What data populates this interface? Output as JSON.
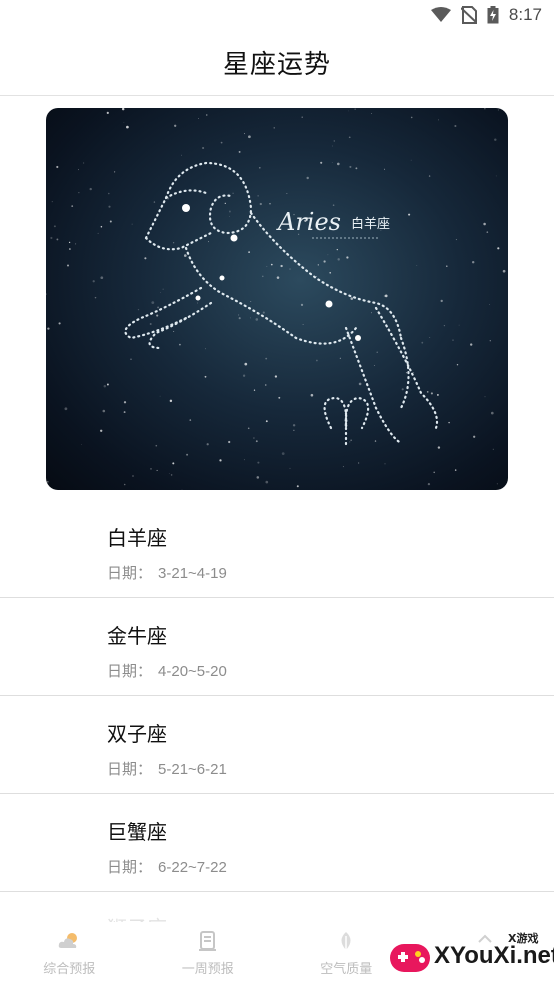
{
  "status_bar": {
    "time": "8:17",
    "icons": [
      "wifi-icon",
      "no-sim-icon",
      "battery-icon"
    ]
  },
  "header": {
    "title": "星座运势"
  },
  "banner": {
    "image_name": "aries-constellation-banner",
    "overlay_title": "Aries",
    "overlay_subtitle": "白羊座"
  },
  "zodiac_list": [
    {
      "name": "白羊座",
      "date_label": "日期：",
      "date_range": "3-21~4-19"
    },
    {
      "name": "金牛座",
      "date_label": "日期：",
      "date_range": "4-20~5-20"
    },
    {
      "name": "双子座",
      "date_label": "日期：",
      "date_range": "5-21~6-21"
    },
    {
      "name": "巨蟹座",
      "date_label": "日期：",
      "date_range": "6-22~7-22"
    }
  ],
  "bottom_nav": {
    "items": [
      {
        "label": "综合预报",
        "icon": "weather-cloud-icon"
      },
      {
        "label": "一周预报",
        "icon": "scroll-icon"
      },
      {
        "label": "空气质量",
        "icon": "leaf-icon"
      },
      {
        "label": "",
        "icon": "arrow-up-icon"
      }
    ]
  },
  "watermark": {
    "text": "XYouXi.net",
    "sub": "X游戏"
  }
}
